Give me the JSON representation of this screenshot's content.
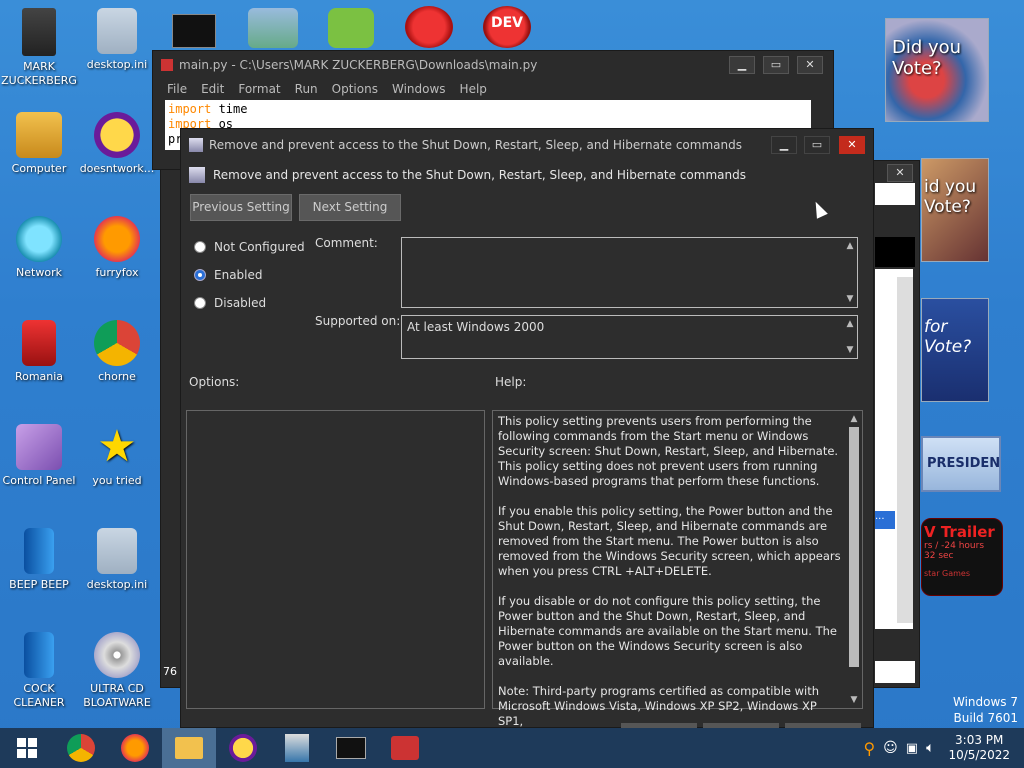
{
  "desktop": {
    "icons": [
      {
        "label": "MARK ZUCKERBERG"
      },
      {
        "label": "desktop.ini"
      },
      {
        "label": "Computer"
      },
      {
        "label": "doesntwork..."
      },
      {
        "label": "Network"
      },
      {
        "label": "furryfox"
      },
      {
        "label": "Romania"
      },
      {
        "label": "chorne"
      },
      {
        "label": "Control Panel"
      },
      {
        "label": "you tried"
      },
      {
        "label": "BEEP BEEP"
      },
      {
        "label": "desktop.ini"
      },
      {
        "label": "COCK CLEANER"
      },
      {
        "label": "ULTRA CD BLOATWARE"
      }
    ],
    "ads": {
      "ad1_text": "Did you Vote?",
      "ad2_text": "id you Vote?",
      "ad3_text": "for Vote?",
      "ad4_text": "PRESIDENT",
      "ad5_title": "V Trailer",
      "ad5_sub": "rs / -24 hours",
      "ad5_sub2": "32 sec",
      "ad5_footer": "star Games"
    },
    "watermark": {
      "line1": "Windows 7",
      "line2": "Build 7601"
    }
  },
  "code_window": {
    "title": "main.py - C:\\Users\\MARK ZUCKERBERG\\Downloads\\main.py",
    "menu": [
      "File",
      "Edit",
      "Format",
      "Run",
      "Options",
      "Windows",
      "Help"
    ],
    "lines": [
      {
        "kw": "import",
        "rest": " time"
      },
      {
        "kw": "import",
        "rest": " os"
      },
      {
        "kw": "pr",
        "rest": ""
      }
    ]
  },
  "policy_dialog": {
    "window_title": "Remove and prevent access to the Shut Down, Restart, Sleep, and Hibernate commands",
    "header_title": "Remove and prevent access to the Shut Down, Restart, Sleep, and Hibernate commands",
    "prev_button": "Previous Setting",
    "next_button": "Next Setting",
    "radio_not_configured": "Not Configured",
    "radio_enabled": "Enabled",
    "radio_disabled": "Disabled",
    "selected_radio": "Enabled",
    "comment_label": "Comment:",
    "comment_value": "",
    "supported_label": "Supported on:",
    "supported_value": "At least Windows 2000",
    "options_label": "Options:",
    "help_label": "Help:",
    "help_paragraphs": [
      "This policy setting prevents users from performing the following commands from the Start menu or Windows Security screen: Shut Down, Restart, Sleep, and Hibernate. This policy setting does not prevent users from running Windows-based programs that perform these functions.",
      "If you enable this policy setting, the Power button and the Shut Down, Restart, Sleep, and Hibernate commands are removed from the Start menu. The Power button is also removed from the Windows Security screen, which appears when you press CTRL +ALT+DELETE.",
      "If you disable or do not configure this policy setting, the Power button and the Shut Down, Restart, Sleep, and Hibernate commands are available on the Start menu. The Power button on the Windows Security screen is also available.",
      "Note: Third-party programs certified as compatible with Microsoft Windows Vista, Windows XP SP2, Windows XP SP1,"
    ]
  },
  "taskbar": {
    "time": "3:03 PM",
    "date": "10/5/2022"
  },
  "behind_window_fragment": {
    "bottom_text": "76"
  }
}
